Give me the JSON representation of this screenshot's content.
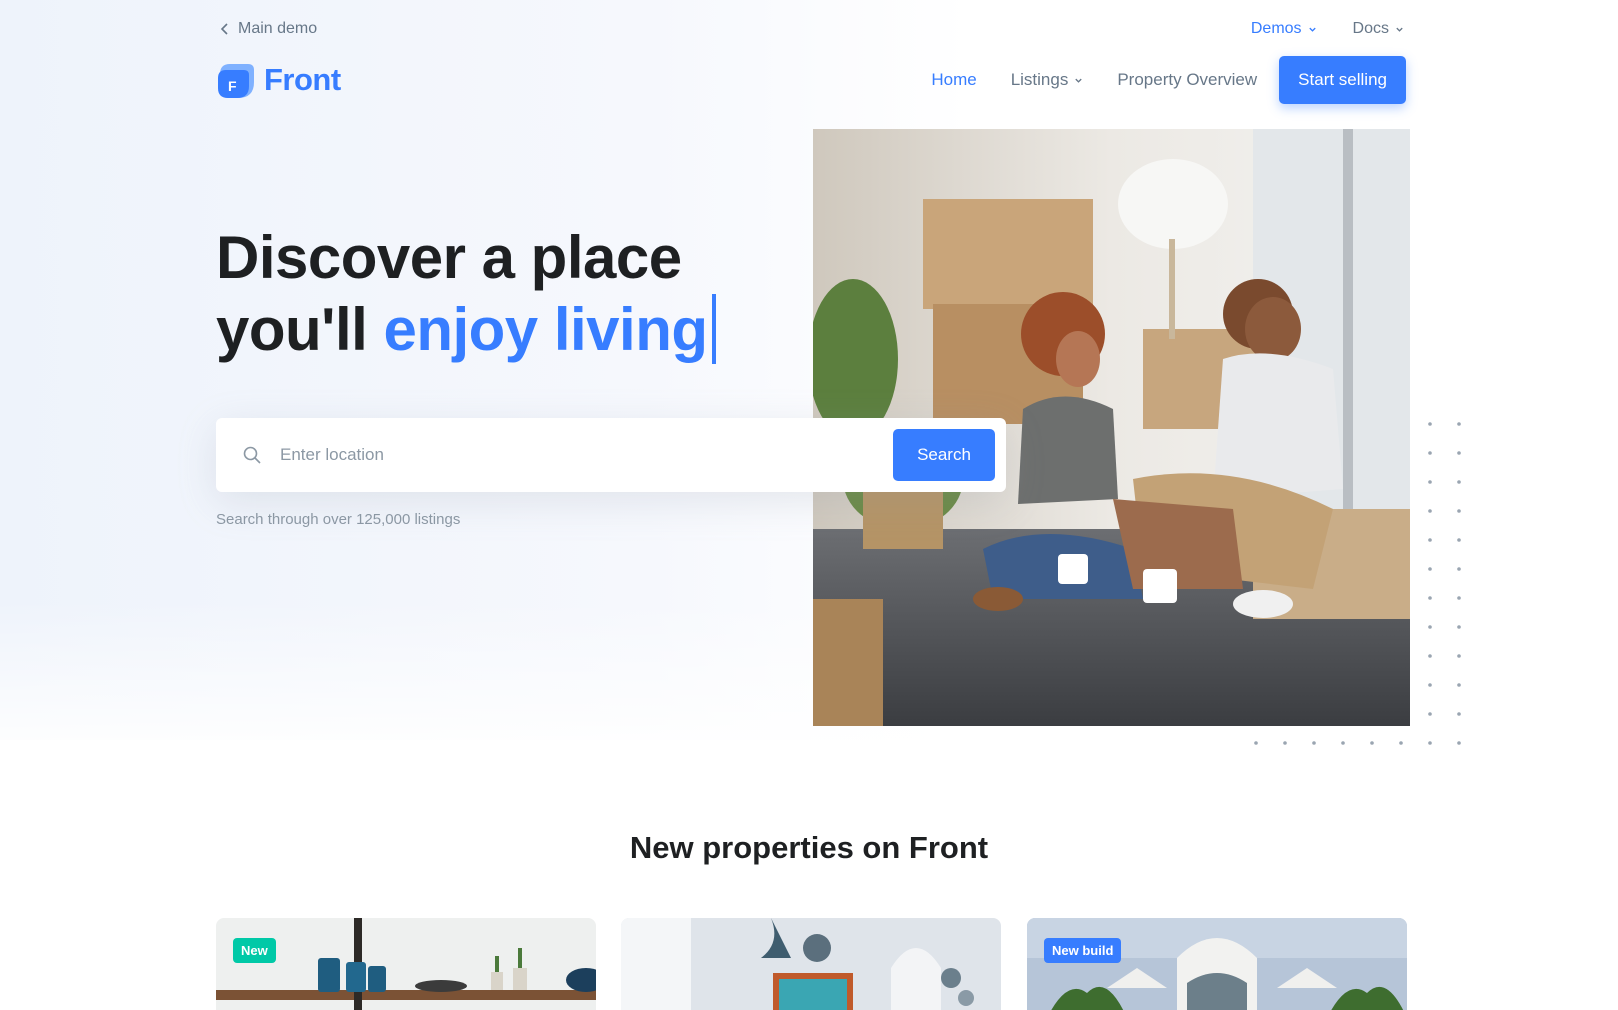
{
  "topbar": {
    "back_label": "Main demo",
    "demos_label": "Demos",
    "docs_label": "Docs"
  },
  "brand": {
    "name": "Front",
    "mark_letter": "F"
  },
  "nav": {
    "home": "Home",
    "listings": "Listings",
    "property_overview": "Property Overview",
    "cta": "Start selling"
  },
  "hero": {
    "line1": "Discover a place",
    "line2_prefix": "you'll",
    "line2_highlight": "enjoy living",
    "search_placeholder": "Enter location",
    "search_button": "Search",
    "hint": "Search through over 125,000 listings"
  },
  "section": {
    "title": "New properties on Front"
  },
  "cards": [
    {
      "badge": "New",
      "badge_color": "#00c9a7"
    },
    {
      "badge": "",
      "badge_color": ""
    },
    {
      "badge": "New build",
      "badge_color": "#377dff"
    }
  ],
  "colors": {
    "accent": "#377dff",
    "text": "#1e2022",
    "muted": "#677788"
  }
}
